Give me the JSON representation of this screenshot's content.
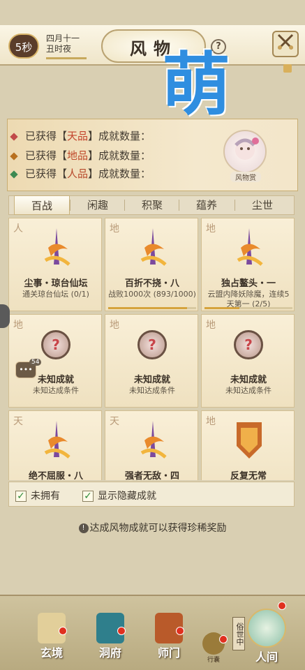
{
  "header": {
    "timer": "5秒",
    "lunar_date_line1": "四月十一",
    "lunar_date_line2": "丑时夜",
    "title": "风物",
    "help_icon": "?",
    "close_icon": "crossed-swords-icon"
  },
  "watermark": "萌",
  "summary": {
    "rows": [
      {
        "prefix": "已获得【",
        "grade": "天品",
        "suffix": "】成就数量：",
        "dot_color": "#c14a4a"
      },
      {
        "prefix": "已获得【",
        "grade": "地品",
        "suffix": "】成就数量：",
        "dot_color": "#b8701f"
      },
      {
        "prefix": "已获得【",
        "grade": "人品",
        "suffix": "】成就数量：",
        "dot_color": "#3d8a52"
      }
    ],
    "badge_label": "风物赏"
  },
  "tabs": [
    {
      "label": "百战",
      "active": true
    },
    {
      "label": "闲趣",
      "active": false
    },
    {
      "label": "积聚",
      "active": false
    },
    {
      "label": "蕴养",
      "active": false
    },
    {
      "label": "尘世",
      "active": false
    }
  ],
  "cards": [
    {
      "corner": "人",
      "name": "尘事・琼台仙坛",
      "desc": "通关琼台仙坛 (0/1)",
      "known": true,
      "progress": 0
    },
    {
      "corner": "地",
      "name": "百折不挠・八",
      "desc": "战败1000次 (893/1000)",
      "known": true,
      "progress": 0.893
    },
    {
      "corner": "地",
      "name": "独占鳌头・一",
      "desc": "云盟内降妖除魔，连续5天第一 (2/5)",
      "known": true,
      "progress": 0.4
    },
    {
      "corner": "地",
      "name": "未知成就",
      "desc": "未知达成条件",
      "known": false,
      "progress": 0
    },
    {
      "corner": "地",
      "name": "未知成就",
      "desc": "未知达成条件",
      "known": false,
      "progress": 0
    },
    {
      "corner": "地",
      "name": "未知成就",
      "desc": "未知达成条件",
      "known": false,
      "progress": 0
    },
    {
      "corner": "天",
      "name": "绝不屈服・八",
      "desc": "",
      "known": true,
      "progress": 0
    },
    {
      "corner": "天",
      "name": "强者无敌・四",
      "desc": "",
      "known": true,
      "progress": 0
    },
    {
      "corner": "地",
      "name": "反复无常",
      "desc": "",
      "known": true,
      "progress": 0
    }
  ],
  "filters": {
    "not_owned": {
      "label": "未拥有",
      "checked": true
    },
    "show_hidden": {
      "label": "显示隐藏成就",
      "checked": true
    }
  },
  "note": "达成风物成就可以获得珍稀奖励",
  "side_chat_count": "54",
  "bottom_nav": [
    {
      "label": "玄境",
      "icon": "scroll-icon"
    },
    {
      "label": "洞府",
      "icon": "pavilion-icon"
    },
    {
      "label": "师门",
      "icon": "banner-icon"
    },
    {
      "label": "行囊",
      "icon": "bag-icon"
    },
    {
      "label": "俗世中",
      "icon": "vertical-sign-icon"
    },
    {
      "label": "人间",
      "icon": "world-icon"
    }
  ],
  "colors": {
    "accent_red": "#c3442d",
    "progress": "#d5a33d",
    "watermark_blue": "#2f8ee0"
  }
}
